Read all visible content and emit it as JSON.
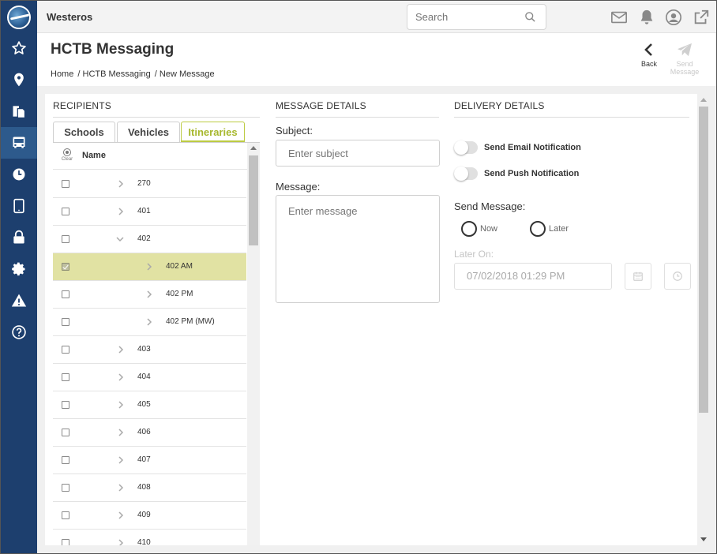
{
  "topbar": {
    "app_name": "Westeros",
    "search_placeholder": "Search"
  },
  "header": {
    "title": "HCTB Messaging",
    "breadcrumbs": [
      "Home",
      "/ HCTB Messaging",
      "/ New Message"
    ],
    "back_label": "Back",
    "send_label": "Send Message"
  },
  "recipients": {
    "title": "RECIPIENTS",
    "tabs": [
      "Schools",
      "Vehicles",
      "Itineraries"
    ],
    "active_tab": "Itineraries",
    "clear_label": "Clear",
    "name_header": "Name",
    "rows": [
      {
        "label": "270",
        "level": 0,
        "expanded": false,
        "checked": false
      },
      {
        "label": "401",
        "level": 0,
        "expanded": false,
        "checked": false
      },
      {
        "label": "402",
        "level": 0,
        "expanded": true,
        "checked": false
      },
      {
        "label": "402 AM",
        "level": 1,
        "expanded": false,
        "checked": true
      },
      {
        "label": "402 PM",
        "level": 1,
        "expanded": false,
        "checked": false
      },
      {
        "label": "402 PM (MW)",
        "level": 1,
        "expanded": false,
        "checked": false
      },
      {
        "label": "403",
        "level": 0,
        "expanded": false,
        "checked": false
      },
      {
        "label": "404",
        "level": 0,
        "expanded": false,
        "checked": false
      },
      {
        "label": "405",
        "level": 0,
        "expanded": false,
        "checked": false
      },
      {
        "label": "406",
        "level": 0,
        "expanded": false,
        "checked": false
      },
      {
        "label": "407",
        "level": 0,
        "expanded": false,
        "checked": false
      },
      {
        "label": "408",
        "level": 0,
        "expanded": false,
        "checked": false
      },
      {
        "label": "409",
        "level": 0,
        "expanded": false,
        "checked": false
      },
      {
        "label": "410",
        "level": 0,
        "expanded": false,
        "checked": false
      }
    ]
  },
  "message": {
    "title": "MESSAGE DETAILS",
    "subject_label": "Subject:",
    "subject_placeholder": "Enter subject",
    "message_label": "Message:",
    "message_placeholder": "Enter message"
  },
  "delivery": {
    "title": "DELIVERY DETAILS",
    "email_toggle_label": "Send Email Notification",
    "push_toggle_label": "Send Push Notification",
    "send_message_label": "Send Message:",
    "now_label": "Now",
    "later_label": "Later",
    "later_on_label": "Later On:",
    "later_on_value": "07/02/2018 01:29 PM"
  },
  "colors": {
    "sidebar": "#1d3f6e",
    "accent": "#a7b82e",
    "selected_row": "#e1e2a3"
  }
}
